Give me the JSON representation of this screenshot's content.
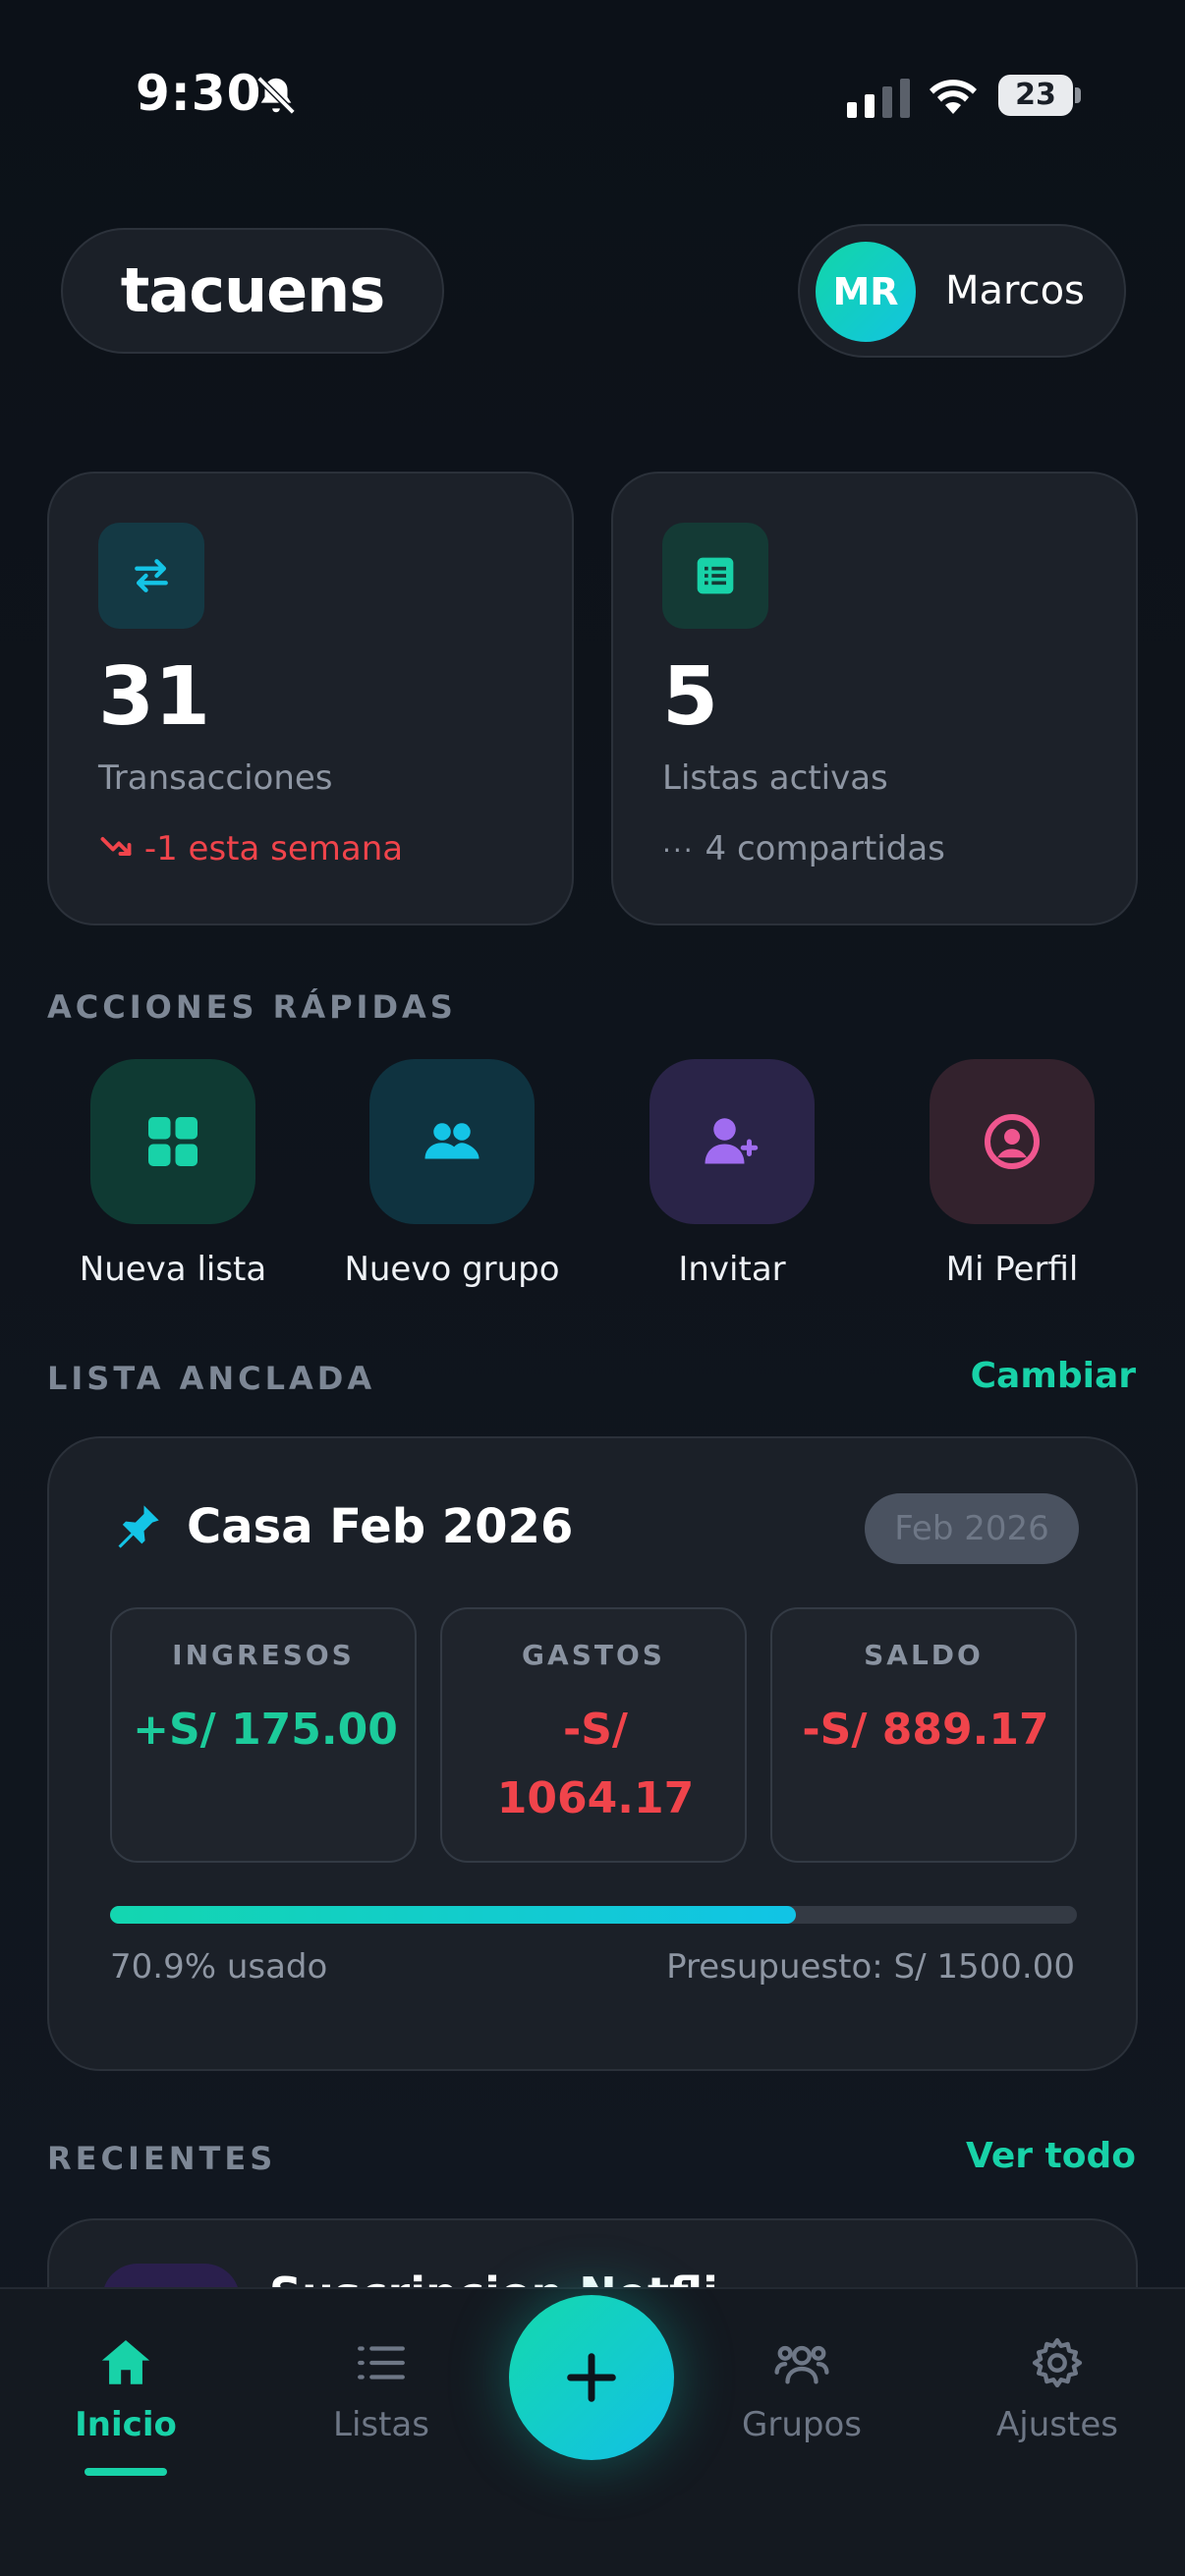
{
  "status_bar": {
    "time": "9:30",
    "battery": "23"
  },
  "header": {
    "logo": "tacuens",
    "user_initials": "MR",
    "user_name": "Marcos"
  },
  "stats": {
    "transactions": {
      "value": "31",
      "label": "Transacciones",
      "change": "-1 esta semana"
    },
    "lists": {
      "value": "5",
      "label": "Listas activas",
      "shared": "4 compartidas"
    }
  },
  "quick_actions": {
    "title": "ACCIONES RÁPIDAS",
    "items": [
      {
        "label": "Nueva lista",
        "icon": "grid-icon",
        "bg": "#0f3a33",
        "color": "#18d2a8"
      },
      {
        "label": "Nuevo grupo",
        "icon": "group-icon",
        "bg": "#0f3340",
        "color": "#14c4e6"
      },
      {
        "label": "Invitar",
        "icon": "user-plus-icon",
        "bg": "#2a2448",
        "color": "#a06cf0"
      },
      {
        "label": "Mi Perfil",
        "icon": "profile-icon",
        "bg": "#33222d",
        "color": "#f0568f"
      }
    ]
  },
  "pinned": {
    "section_title": "LISTA ANCLADA",
    "change_link": "Cambiar",
    "title": "Casa Feb 2026",
    "month": "Feb 2026",
    "income_label": "INGRESOS",
    "income_value": "+S/ 175.00",
    "expenses_label": "GASTOS",
    "expenses_value_line1": "-S/",
    "expenses_value_line2": "1064.17",
    "balance_label": "SALDO",
    "balance_value": "-S/ 889.17",
    "used_percent": 70.9,
    "used_text": "70.9% usado",
    "budget_text": "Presupuesto: S/ 1500.00"
  },
  "recent": {
    "section_title": "RECIENTES",
    "see_all": "Ver todo",
    "first_title": "Suscripcion Netfli"
  },
  "nav": {
    "home": "Inicio",
    "lists": "Listas",
    "groups": "Grupos",
    "settings": "Ajustes"
  },
  "colors": {
    "accent": "#18d2a8",
    "negative": "#f0444b",
    "positive": "#1ccb9b"
  }
}
